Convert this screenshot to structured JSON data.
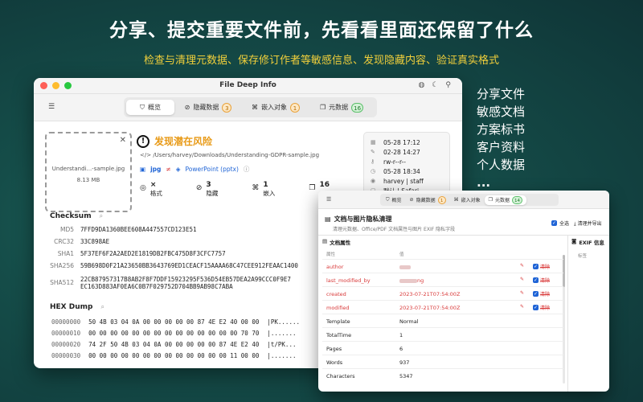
{
  "headline": "分享、提交重要文件前，先看看里面还保留了什么",
  "subline": "检查与清理元数据、保存修订作者等敏感信息、发现隐藏内容、验证真实格式",
  "side_list": [
    "分享文件",
    "敏感文档",
    "方案标书",
    "客户资料",
    "个人数据",
    "..."
  ],
  "window": {
    "title": "File Deep Info",
    "tabs": [
      {
        "label": "概览",
        "icon": "shield-icon"
      },
      {
        "label": "隐藏数据",
        "badge": "3"
      },
      {
        "label": "嵌入对象",
        "badge": "1"
      },
      {
        "label": "元数据",
        "badge": "16"
      }
    ],
    "file": {
      "name": "Understandi...-sample.jpg",
      "size": "8.13 MB"
    },
    "risk_text": "发现潜在风险",
    "path": "/Users/harvey/Downloads/Understanding-GDPR-sample.jpg",
    "ext": "jpg",
    "neq": "≠",
    "real_type": "PowerPoint (pptx)",
    "stats": [
      {
        "value": "×",
        "label": "格式"
      },
      {
        "value": "3",
        "label": "隐藏"
      },
      {
        "value": "1",
        "label": "嵌入"
      },
      {
        "value": "16",
        "label": ""
      }
    ],
    "meta": [
      {
        "icon": "calendar-icon",
        "text": "05-28 17:12"
      },
      {
        "icon": "edit-icon",
        "text": "02-28 14:27"
      },
      {
        "icon": "key-icon",
        "text": "rw-r--r--"
      },
      {
        "icon": "clock-icon",
        "text": "05-28 18:34"
      },
      {
        "icon": "user-icon",
        "text": "harvey | staff"
      },
      {
        "icon": "app-icon",
        "text": "默认 | Safari"
      }
    ],
    "checksum_title": "Checksum",
    "hashes": [
      {
        "label": "MD5",
        "value": "7FFD9DA1360BEE608A447557CD123E51"
      },
      {
        "label": "CRC32",
        "value": "33C898AE"
      },
      {
        "label": "SHA1",
        "value": "5F37EF6F2A2AED2E1819DB2FBC475D8F3CFC7757"
      },
      {
        "label": "SHA256",
        "value": "59B698D0F21A23650BB3643769ED1CEACF15AAAA68C47CEE912FEAAC1400"
      },
      {
        "label": "SHA512",
        "value": "22CB87957317B8AB2F8F7DDF15923295F536D54EB57DEA2A99CCC0F9E7",
        "value2": "EC163D883AF0EA6C0B7F029752D704BB9AB98C7ABA"
      }
    ],
    "hex_title": "HEX Dump",
    "hex": [
      {
        "addr": "00000000",
        "bytes": "50 4B 03 04 0A 00 00 00 00 00 87 4E E2 40 00 00",
        "ascii": "|PK......"
      },
      {
        "addr": "00000010",
        "bytes": "00 00 00 00 00 00 00 00 00 00 00 00 00 00 70 70",
        "ascii": "|......."
      },
      {
        "addr": "00000020",
        "bytes": "74 2F 50 4B 03 04 0A 00 00 00 00 00 87 4E E2 40",
        "ascii": "|t/PK..."
      },
      {
        "addr": "00000030",
        "bytes": "00 00 00 00 00 00 00 00 00 00 00 00 00 11 00 00",
        "ascii": "|......."
      }
    ]
  },
  "window2": {
    "tabs": [
      {
        "label": "概览"
      },
      {
        "label": "隐藏数据",
        "badge": "1"
      },
      {
        "label": "嵌入对象"
      },
      {
        "label": "元数据",
        "badge": "14"
      }
    ],
    "heading": "文档与图片隐私清理",
    "sub": "清理元数据、Office/PDF 文档属性与图片 EXIF 隐私字段",
    "select_all": "全选",
    "export": "清理并导出",
    "section": "文档属性",
    "col_attr": "属性",
    "col_val": "值",
    "exif_title": "EXIF 信息",
    "exif_sub": "标签",
    "clean_label": "清除",
    "rows": [
      {
        "key": "author",
        "value": "",
        "red": true
      },
      {
        "key": "last_modified_by",
        "value": "ng",
        "red": true
      },
      {
        "key": "created",
        "value": "2023-07-21T07:54:00Z",
        "red": true
      },
      {
        "key": "modified",
        "value": "2023-07-21T07:54:00Z",
        "red": true
      },
      {
        "key": "Template",
        "value": "Normal",
        "red": false
      },
      {
        "key": "TotalTime",
        "value": "1",
        "red": false
      },
      {
        "key": "Pages",
        "value": "6",
        "red": false
      },
      {
        "key": "Words",
        "value": "937",
        "red": false
      },
      {
        "key": "Characters",
        "value": "5347",
        "red": false
      }
    ]
  }
}
